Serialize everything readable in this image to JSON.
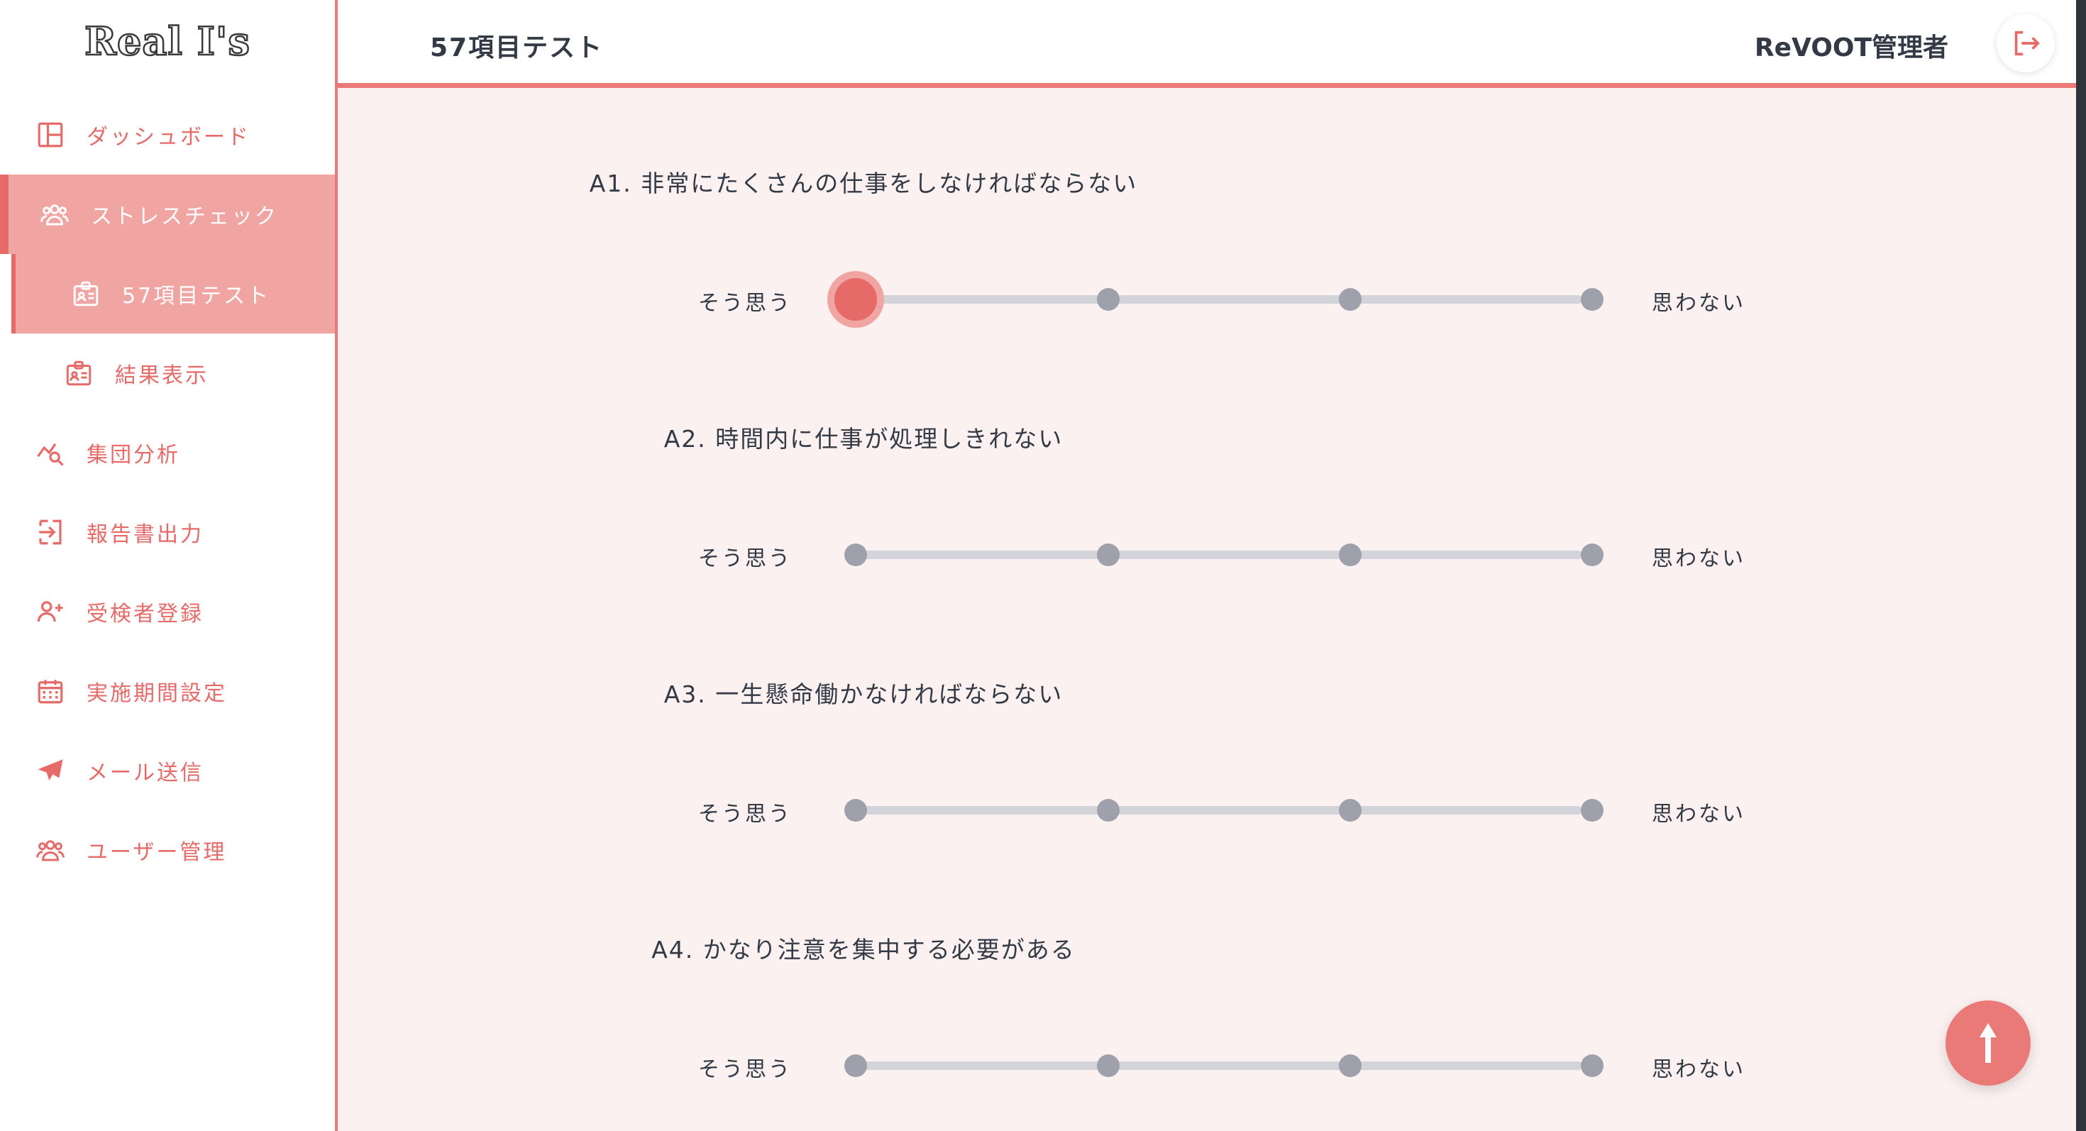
{
  "app": {
    "logo": "Real I's"
  },
  "sidebar": {
    "items": [
      {
        "label": "ダッシュボード",
        "icon": "dashboard-icon"
      },
      {
        "label": "ストレスチェック",
        "icon": "group-icon"
      },
      {
        "label": "57項目テスト",
        "icon": "id-card-icon"
      },
      {
        "label": "結果表示",
        "icon": "id-card-icon"
      },
      {
        "label": "集団分析",
        "icon": "chart-search-icon"
      },
      {
        "label": "報告書出力",
        "icon": "export-icon"
      },
      {
        "label": "受検者登録",
        "icon": "user-add-icon"
      },
      {
        "label": "実施期間設定",
        "icon": "calendar-icon"
      },
      {
        "label": "メール送信",
        "icon": "send-icon"
      },
      {
        "label": "ユーザー管理",
        "icon": "group-icon"
      }
    ]
  },
  "header": {
    "title": "57項目テスト",
    "user": "ReVOOT管理者"
  },
  "scale": {
    "left_label": "そう思う",
    "right_label": "思わない"
  },
  "questions": [
    {
      "title": "A1. 非常にたくさんの仕事をしなければならない",
      "selected": 1
    },
    {
      "title": "A2. 時間内に仕事が処理しきれない",
      "selected": null
    },
    {
      "title": "A3. 一生懸命働かなければならない",
      "selected": null
    },
    {
      "title": "A4. かなり注意を集中する必要がある",
      "selected": null
    }
  ],
  "colors": {
    "accent": "#e66a68",
    "accent_light": "#f0a5a3",
    "background": "#fbf1f0",
    "track": "#d2d4da",
    "dot": "#9ea1ab"
  }
}
